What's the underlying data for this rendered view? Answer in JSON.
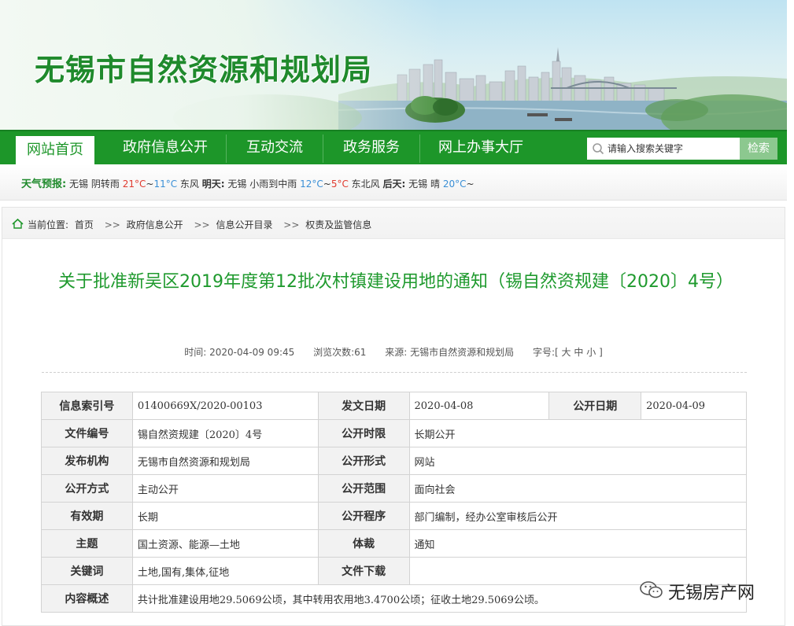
{
  "site": {
    "title": "无锡市自然资源和规划局"
  },
  "nav": {
    "tabs": [
      "网站首页",
      "政府信息公开",
      "互动交流",
      "政务服务",
      "网上办事大厅"
    ],
    "active_index": 0,
    "search_placeholder": "请输入搜索关键字",
    "search_button": "检索"
  },
  "weather": {
    "label": "天气预报:",
    "today_city": "无锡",
    "today_cond": "阴转雨",
    "today_high": "21°C",
    "today_sep": "~",
    "today_low": "11°C",
    "today_wind": "东风",
    "tomorrow_label": "明天:",
    "tomorrow_city": "无锡",
    "tomorrow_cond": "小雨到中雨",
    "tomorrow_high": "12°C",
    "tomorrow_sep": "~",
    "tomorrow_low": "5°C",
    "tomorrow_wind": "东北风",
    "dayafter_label": "后天:",
    "dayafter_city": "无锡",
    "dayafter_cond": "晴",
    "dayafter_high": "20°C",
    "dayafter_sep": "~"
  },
  "breadcrumb": {
    "prefix": "当前位置:",
    "items": [
      "首页",
      "政府信息公开",
      "信息公开目录",
      "权责及监管信息"
    ],
    "separator": ">>"
  },
  "article": {
    "title": "关于批准新吴区2019年度第12批次村镇建设用地的通知（锡自然资规建〔2020〕4号）",
    "time_label": "时间:",
    "time": "2020-04-09 09:45",
    "views_label": "浏览次数:",
    "views": "61",
    "source_label": "来源:",
    "source": "无锡市自然资源和规划局",
    "fontsize_label": "字号:",
    "fontsize_open": "[",
    "fontsize_large": "大",
    "fontsize_medium": "中",
    "fontsize_small": "小",
    "fontsize_close": "]"
  },
  "info_table": {
    "index_label": "信息索引号",
    "index_value": "01400669X/2020-00103",
    "issue_date_label": "发文日期",
    "issue_date_value": "2020-04-08",
    "publish_date_label": "公开日期",
    "publish_date_value": "2020-04-09",
    "doc_no_label": "文件编号",
    "doc_no_value": "锡自然资规建〔2020〕4号",
    "term_label": "公开时限",
    "term_value": "长期公开",
    "org_label": "发布机构",
    "org_value": "无锡市自然资源和规划局",
    "form_label": "公开形式",
    "form_value": "网站",
    "method_label": "公开方式",
    "method_value": "主动公开",
    "scope_label": "公开范围",
    "scope_value": "面向社会",
    "validity_label": "有效期",
    "validity_value": "长期",
    "procedure_label": "公开程序",
    "procedure_value": "部门编制，经办公室审核后公开",
    "topic_label": "主题",
    "topic_value": "国土资源、能源—土地",
    "genre_label": "体裁",
    "genre_value": "通知",
    "keywords_label": "关键词",
    "keywords_value": "土地,国有,集体,征地",
    "download_label": "文件下载",
    "download_value": "",
    "summary_label": "内容概述",
    "summary_value": "共计批准建设用地29.5069公顷，其中转用农用地3.4700公顷；征收土地29.5069公顷。"
  },
  "watermark": {
    "text": "无锡房产网"
  },
  "colors": {
    "brand_green": "#1d9629",
    "title_green": "#1f9a2e",
    "hot": "#e03a2e",
    "cold": "#3a8fd6"
  }
}
